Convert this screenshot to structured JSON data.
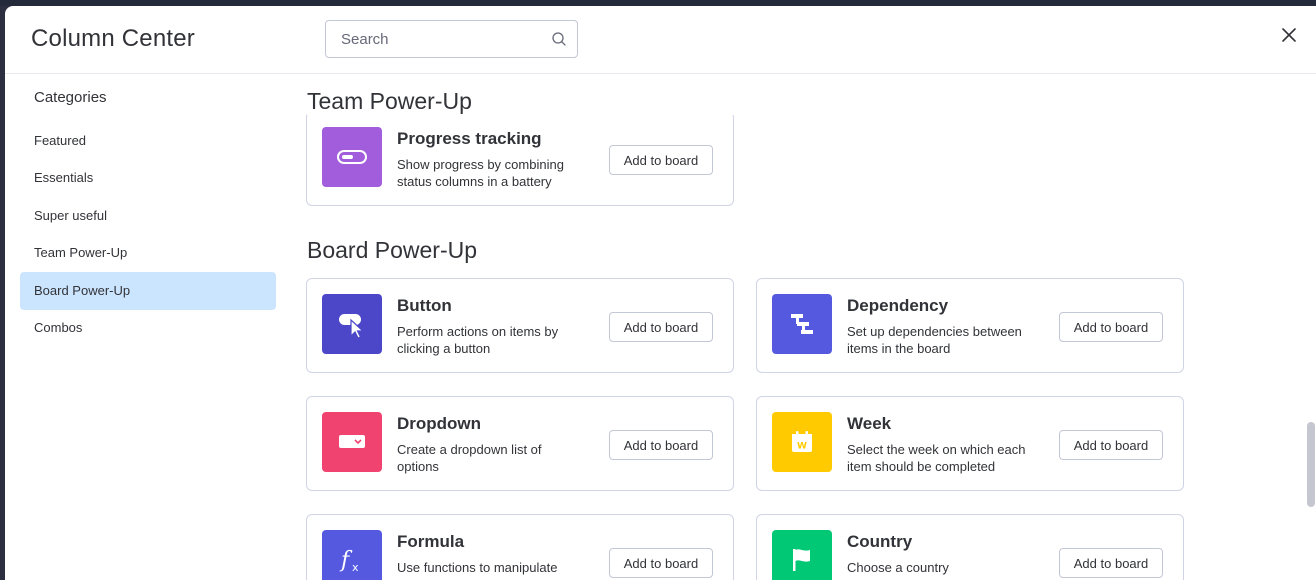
{
  "modal": {
    "title": "Column Center",
    "search_placeholder": "Search"
  },
  "sidebar": {
    "heading": "Categories",
    "items": [
      {
        "label": "Featured"
      },
      {
        "label": "Essentials"
      },
      {
        "label": "Super useful"
      },
      {
        "label": "Team Power-Up"
      },
      {
        "label": "Board Power-Up",
        "active": true
      },
      {
        "label": "Combos"
      }
    ]
  },
  "sections": {
    "team": {
      "title": "Team Power-Up",
      "cards": [
        {
          "name": "Progress tracking",
          "desc": "Show progress by combining status columns in a battery",
          "icon": "battery-icon",
          "color": "#a25ddc",
          "button": "Add to board"
        }
      ]
    },
    "board": {
      "title": "Board Power-Up",
      "cards": [
        {
          "name": "Button",
          "desc": "Perform actions on items by clicking a button",
          "icon": "button-click-icon",
          "color": "#4c46c8",
          "button": "Add to board"
        },
        {
          "name": "Dependency",
          "desc": "Set up dependencies between items in the board",
          "icon": "dependency-icon",
          "color": "#5559df",
          "button": "Add to board"
        },
        {
          "name": "Dropdown",
          "desc": "Create a dropdown list of options",
          "icon": "dropdown-icon",
          "color": "#f04370",
          "button": "Add to board"
        },
        {
          "name": "Week",
          "desc": "Select the week on which each item should be completed",
          "icon": "calendar-week-icon",
          "color": "#ffcb00",
          "button": "Add to board"
        },
        {
          "name": "Formula",
          "desc": "Use functions to manipulate",
          "icon": "formula-icon",
          "color": "#5559df",
          "button": "Add to board"
        },
        {
          "name": "Country",
          "desc": "Choose a country",
          "icon": "flag-icon",
          "color": "#00c875",
          "button": "Add to board"
        }
      ]
    }
  }
}
